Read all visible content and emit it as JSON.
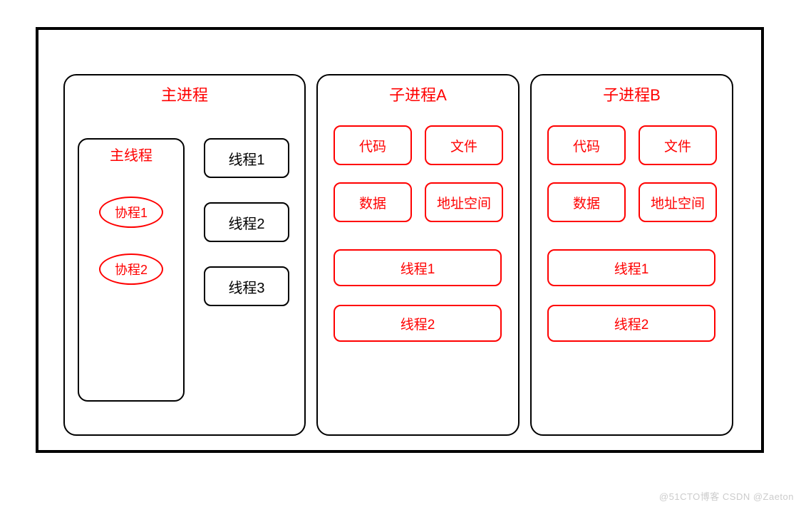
{
  "main_process": {
    "title": "主进程",
    "main_thread": {
      "title": "主线程",
      "coroutines": [
        "协程1",
        "协程2"
      ]
    },
    "threads": [
      "线程1",
      "线程2",
      "线程3"
    ]
  },
  "subprocess_a": {
    "title": "子进程A",
    "resources": {
      "code": "代码",
      "file": "文件",
      "data": "数据",
      "addr": "地址空间"
    },
    "threads": [
      "线程1",
      "线程2"
    ]
  },
  "subprocess_b": {
    "title": "子进程B",
    "resources": {
      "code": "代码",
      "file": "文件",
      "data": "数据",
      "addr": "地址空间"
    },
    "threads": [
      "线程1",
      "线程2"
    ]
  },
  "watermark": "@51CTO博客  CSDN @Zaeton"
}
